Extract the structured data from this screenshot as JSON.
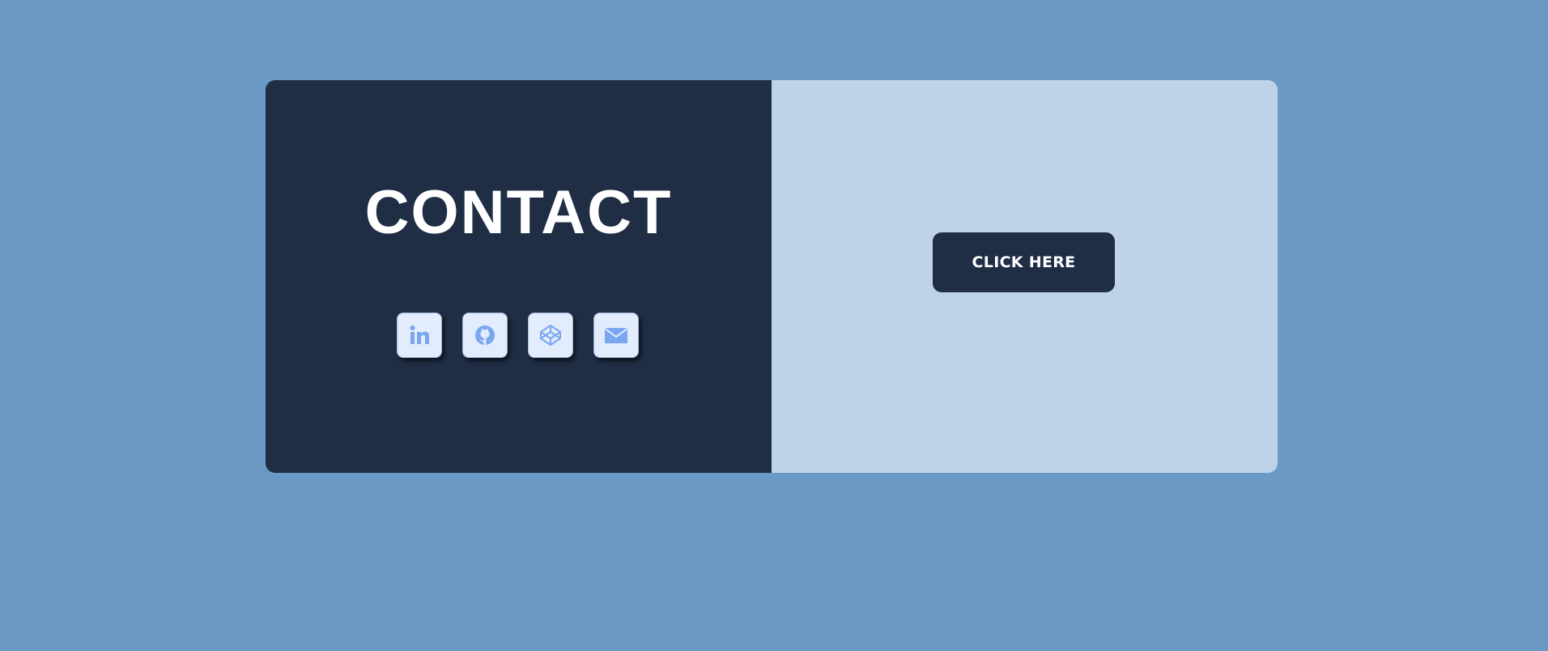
{
  "contact": {
    "title": "CONTACT",
    "social_links": [
      {
        "name": "linkedin",
        "icon": "linkedin-icon"
      },
      {
        "name": "github",
        "icon": "github-icon"
      },
      {
        "name": "codepen",
        "icon": "codepen-icon"
      },
      {
        "name": "email",
        "icon": "mail-icon"
      }
    ]
  },
  "action": {
    "button_label": "CLICK HERE"
  },
  "colors": {
    "page_background": "#6a9ac4",
    "dark_panel": "#1f2d45",
    "light_panel": "#bed3e8",
    "icon_tile": "#e2ecfc",
    "icon_accent": "#7aa6f0"
  }
}
